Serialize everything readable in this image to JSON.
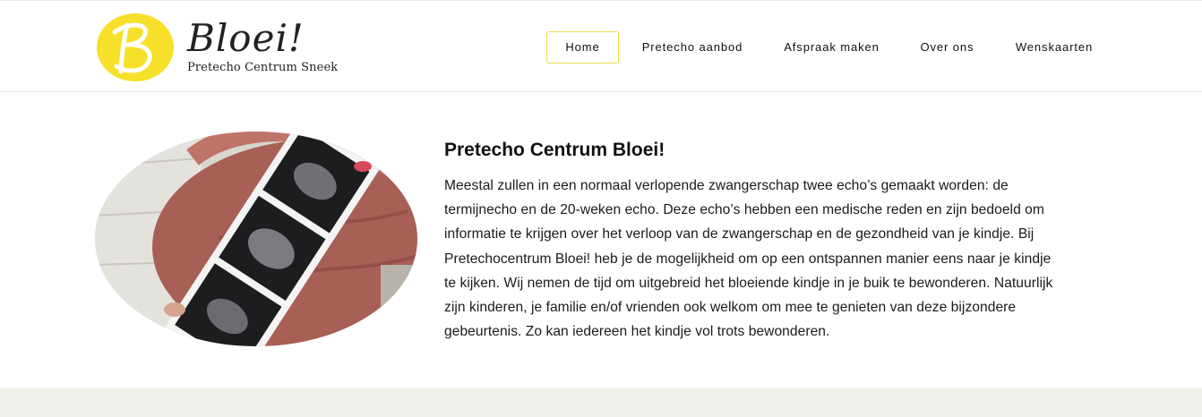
{
  "logo": {
    "word": "Bloei!",
    "subtitle": "Pretecho Centrum Sneek",
    "color": "#f6e02a"
  },
  "nav": {
    "items": [
      {
        "label": "Home",
        "active": true
      },
      {
        "label": "Pretecho aanbod",
        "active": false
      },
      {
        "label": "Afspraak maken",
        "active": false
      },
      {
        "label": "Over ons",
        "active": false
      },
      {
        "label": "Wenskaarten",
        "active": false
      }
    ]
  },
  "hero_image": {
    "alt_icon": "pregnant-belly-ultrasound-photo"
  },
  "main": {
    "title": "Pretecho Centrum Bloei!",
    "lines": [
      "Meestal zullen in een normaal verlopende zwangerschap twee echo’s gemaakt worden: de",
      "termijnecho en de 20-weken echo. Deze echo’s hebben een medische reden en zijn bedoeld om",
      "informatie te krijgen over het verloop van de zwangerschap en de gezondheid van je kindje. Bij",
      "Pretechocentrum Bloei! heb je de mogelijkheid om op een ontspannen manier eens naar je kindje",
      "te kijken. Wij nemen de tijd om uitgebreid het bloeiende kindje in je buik te bewonderen. Natuurlijk",
      "zijn kinderen, je familie en/of vrienden ook welkom om mee te genieten van deze bijzondere",
      "gebeurtenis. Zo kan iedereen het kindje vol trots bewonderen."
    ]
  },
  "colors": {
    "accent": "#f6e02a",
    "footer_band": "#efeee9"
  }
}
